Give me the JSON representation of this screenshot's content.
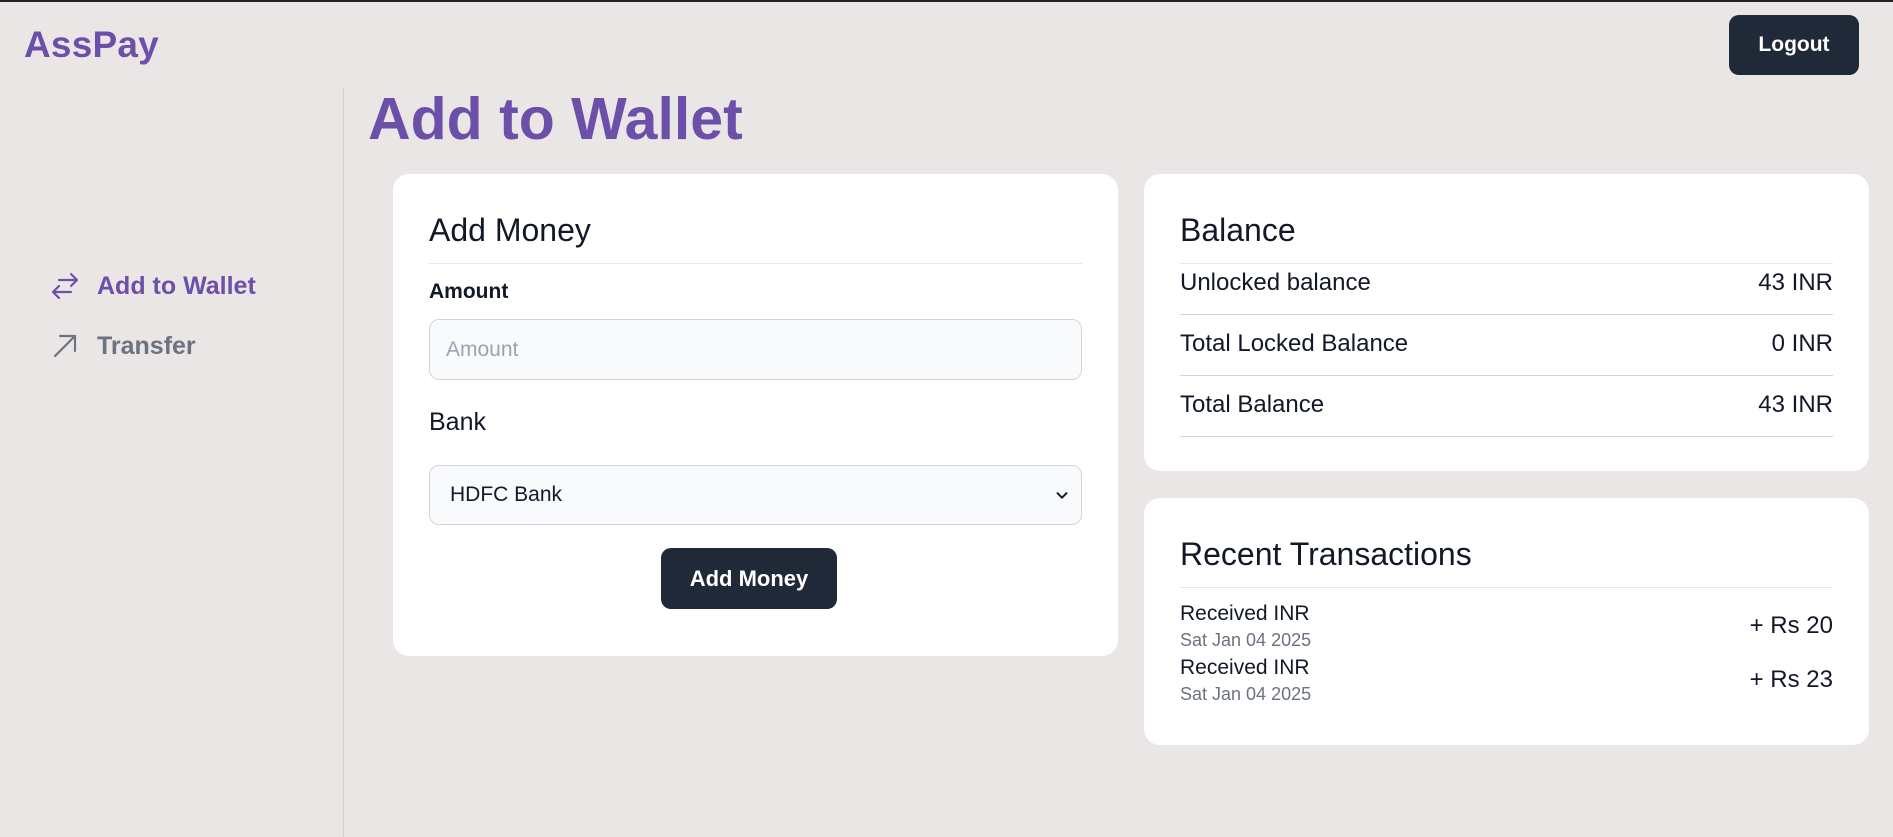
{
  "header": {
    "brand": "AssPay",
    "logout_label": "Logout"
  },
  "sidebar": {
    "items": [
      {
        "label": "Add to Wallet",
        "icon": "arrows-left-right-icon",
        "active": true
      },
      {
        "label": "Transfer",
        "icon": "arrow-up-right-icon",
        "active": false
      }
    ]
  },
  "main": {
    "title": "Add to Wallet"
  },
  "add_money": {
    "title": "Add Money",
    "amount_label": "Amount",
    "amount_placeholder": "Amount",
    "amount_value": "",
    "bank_label": "Bank",
    "bank_selected": "HDFC Bank",
    "submit_label": "Add Money"
  },
  "balance": {
    "title": "Balance",
    "rows": [
      {
        "label": "Unlocked balance",
        "value": "43 INR"
      },
      {
        "label": "Total Locked Balance",
        "value": "0 INR"
      },
      {
        "label": "Total Balance",
        "value": "43 INR"
      }
    ]
  },
  "transactions": {
    "title": "Recent Transactions",
    "items": [
      {
        "title": "Received INR",
        "date": "Sat Jan 04 2025",
        "amount": "+ Rs 20"
      },
      {
        "title": "Received INR",
        "date": "Sat Jan 04 2025",
        "amount": "+ Rs 23"
      }
    ]
  },
  "colors": {
    "accent": "#6b4fa8",
    "button_dark": "#1f2937",
    "background": "#ebe6e6"
  }
}
